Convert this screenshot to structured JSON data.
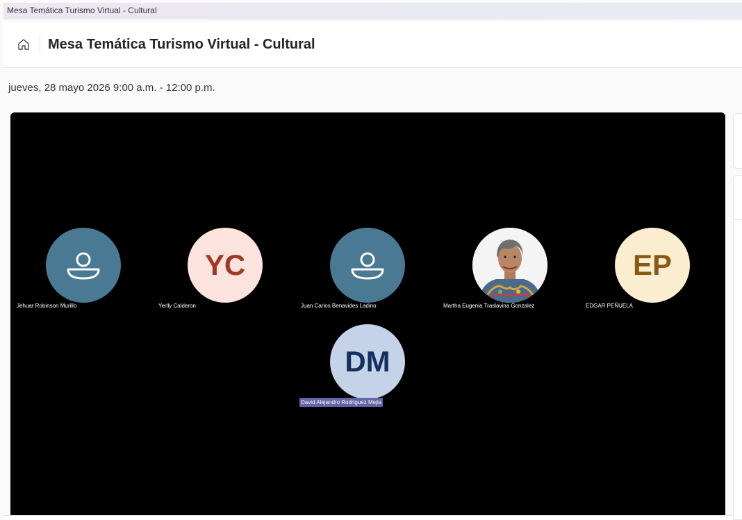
{
  "window": {
    "title": "Mesa Temática Turismo Virtual - Cultural"
  },
  "header": {
    "title": "Mesa Temática Turismo Virtual - Cultural"
  },
  "meeting": {
    "datetime": "jueves, 28 mayo 2026 9:00 a.m. - 12:00 p.m."
  },
  "colors": {
    "generic_avatar_bg": "#4a7a93",
    "yc_bg": "#fde3dd",
    "yc_fg": "#a03a27",
    "ep_bg": "#fbeed0",
    "ep_fg": "#8a5a14",
    "dm_bg": "#c5d3e8",
    "dm_fg": "#14305e",
    "highlight_name_bg": "#6264a7"
  },
  "participants": [
    {
      "name": "Jehuar Robinson Murillo",
      "avatar": "person-icon"
    },
    {
      "name": "Yerlly Calderon",
      "initials": "YC"
    },
    {
      "name": "Juan Carlos Benavides Ladino",
      "avatar": "person-icon"
    },
    {
      "name": "Martha Eugenia Traslavina Gonzalez",
      "avatar": "photo"
    },
    {
      "name": "EDGAR PEÑUELA",
      "initials": "EP"
    },
    {
      "name": "David Alejandro Rodriguez Mejia",
      "initials": "DM",
      "speaking": true
    }
  ]
}
